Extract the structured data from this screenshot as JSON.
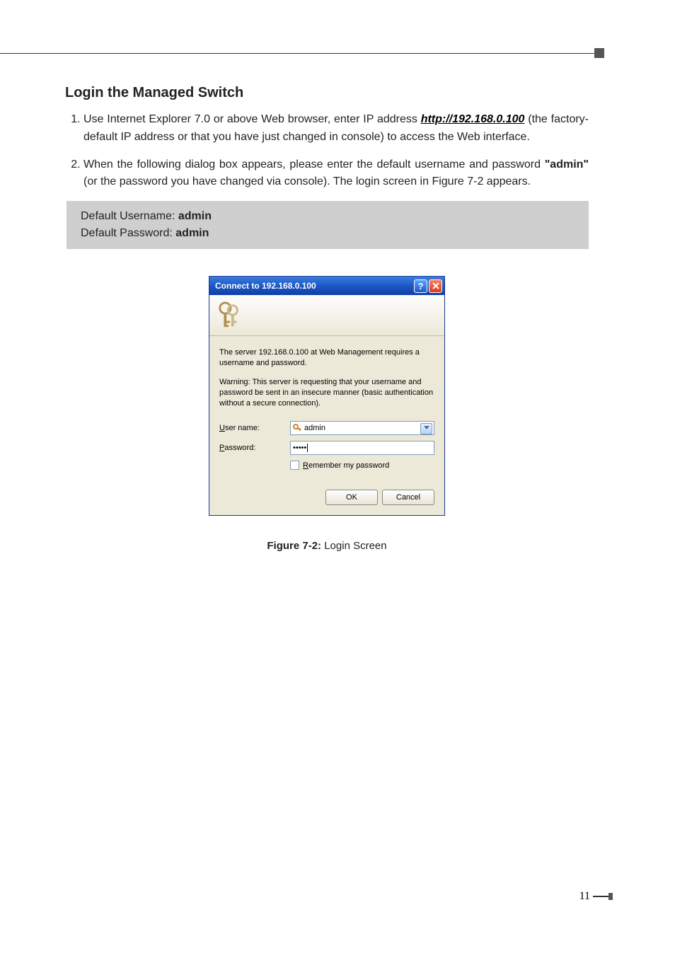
{
  "header": {},
  "section": {
    "heading": "Login the Managed Switch",
    "step1_a": "Use Internet Explorer 7.0 or above Web browser, enter IP address ",
    "step1_link": "http://192.168.0.100",
    "step1_b": " (the factory-default IP address or that you have just changed in console) to access the Web interface.",
    "step2_a": "When the following dialog box appears, please enter the default username and password ",
    "step2_bold": "\"admin\"",
    "step2_b": " (or the password you have changed via console). The login screen in Figure 7-2 appears.",
    "defaults": {
      "user_label": "Default Username: ",
      "user_value": "admin",
      "pass_label": "Default Password: ",
      "pass_value": "admin"
    }
  },
  "dialog": {
    "title": "Connect to 192.168.0.100",
    "msg1": "The server 192.168.0.100 at Web Management requires a username and password.",
    "msg2": "Warning: This server is requesting that your username and password be sent in an insecure manner (basic authentication without a secure connection).",
    "user_label_pre": "U",
    "user_label_post": "ser name:",
    "pass_label_pre": "P",
    "pass_label_post": "assword:",
    "user_value": "admin",
    "pass_value": "•••••",
    "remember_pre": "R",
    "remember_post": "emember my password",
    "ok": "OK",
    "cancel": "Cancel"
  },
  "caption": {
    "label": "Figure 7-2:",
    "text": "  Login Screen"
  },
  "page_number": "11"
}
